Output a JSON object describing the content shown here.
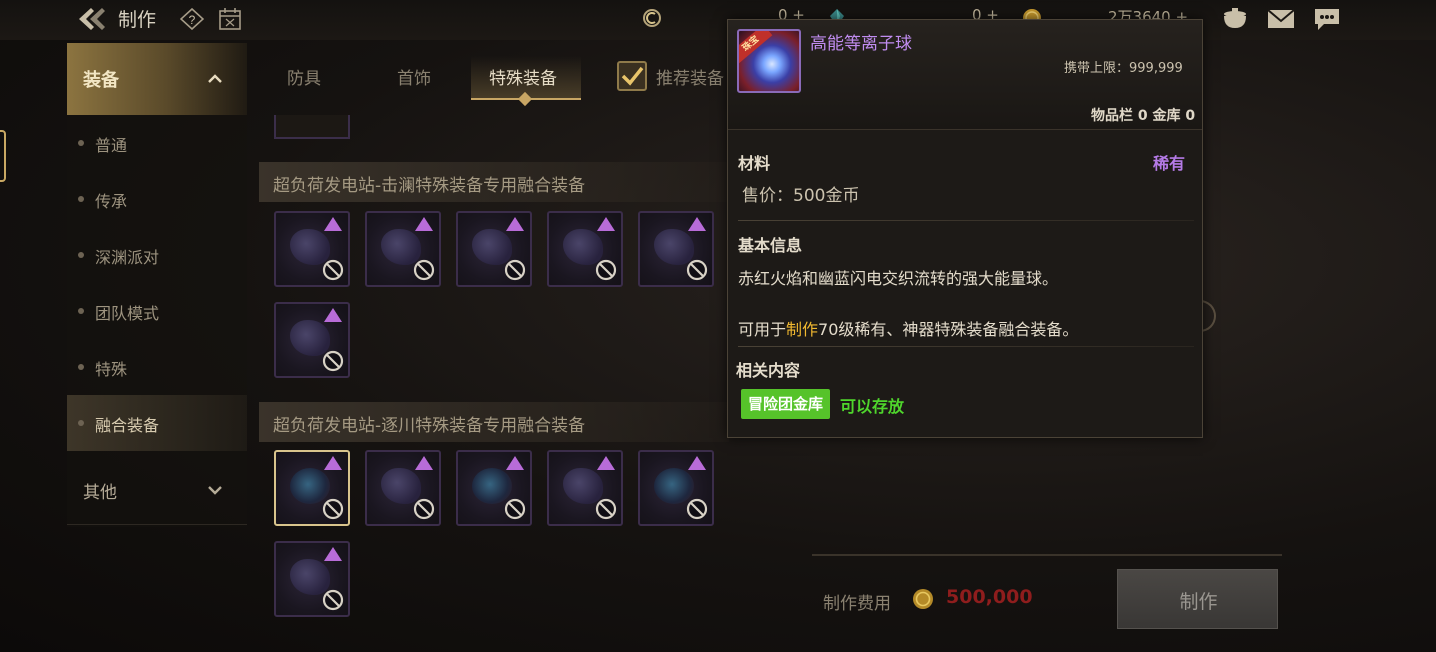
{
  "header": {
    "title": "制作",
    "currencies": [
      {
        "value": "0 +",
        "icon": "rune-currency-icon"
      },
      {
        "value": "0 +",
        "icon": "crystal-icon"
      },
      {
        "value": "2万3640 +",
        "icon": "gold-coin-icon"
      }
    ],
    "icons": [
      "back-arrow-icon",
      "help-icon",
      "calendar-icon",
      "pot-icon",
      "mail-icon",
      "chat-icon"
    ]
  },
  "sidebar": {
    "category_equip": "装备",
    "items": [
      {
        "label": "普通"
      },
      {
        "label": "传承"
      },
      {
        "label": "深渊派对"
      },
      {
        "label": "团队模式"
      },
      {
        "label": "特殊"
      },
      {
        "label": "融合装备",
        "active": true
      }
    ],
    "category_other": "其他"
  },
  "tabs": [
    {
      "label": "防具"
    },
    {
      "label": "首饰"
    },
    {
      "label": "特殊装备",
      "active": true
    }
  ],
  "recommend": {
    "label": "推荐装备",
    "checked": true
  },
  "sections": [
    {
      "title": "超负荷发电站-击澜特殊装备专用融合装备",
      "item_count": 6
    },
    {
      "title": "超负荷发电站-逐川特殊装备专用融合装备",
      "item_count": 6
    }
  ],
  "craft": {
    "cost_label": "制作费用",
    "cost_value": "500,000",
    "button_label": "制作"
  },
  "tooltip": {
    "item_name": "高能等离子球",
    "icon_tag": "珠宝",
    "carry_limit_label": "携带上限：",
    "carry_limit_value": "999,999",
    "storage": "物品栏 0 金库 0",
    "item_type": "材料",
    "rarity": "稀有",
    "price": "售价：500金币",
    "basic_info_title": "基本信息",
    "description_1": "赤红火焰和幽蓝闪电交织流转的强大能量球。",
    "description_2_prefix": "可用于",
    "description_2_highlight": "制作",
    "description_2_suffix": "70级稀有、神器特殊装备融合装备。",
    "related_title": "相关内容",
    "badge_label": "冒险团金库",
    "badge_status": "可以存放"
  },
  "colors": {
    "accent_gold": "#c8a664",
    "rarity_purple": "#b47ae6",
    "highlight_yellow": "#f0b830",
    "success_green": "#56c32a",
    "cost_red": "#8f1d1d"
  }
}
